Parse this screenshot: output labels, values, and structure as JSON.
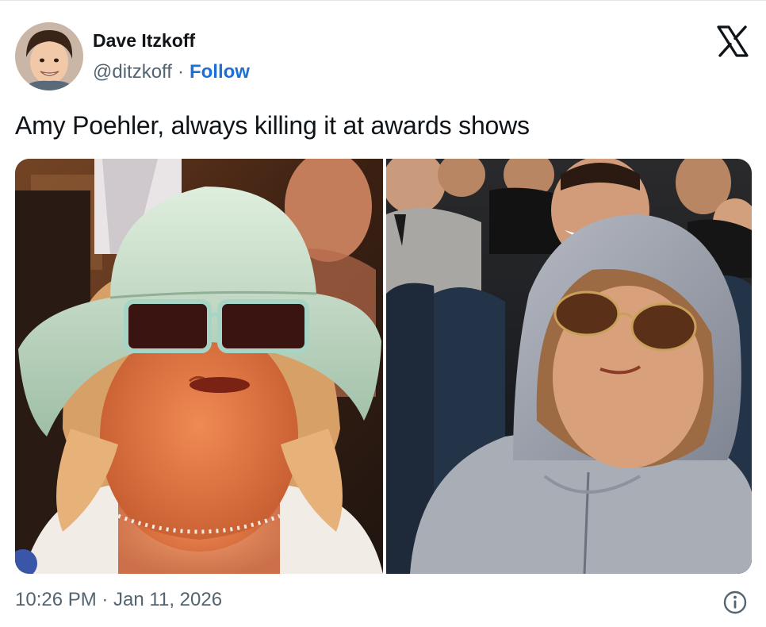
{
  "author": {
    "display_name": "Dave Itzkoff",
    "handle": "@ditzkoff",
    "separator": "·",
    "follow_label": "Follow"
  },
  "tweet": {
    "text": "Amy Poehler, always killing it at awards shows",
    "timestamp": "10:26 PM · Jan 11, 2026"
  },
  "media": {
    "count": 2,
    "items": [
      "photo-left",
      "photo-right"
    ]
  },
  "icons": {
    "brand": "x-logo-icon",
    "info": "info-icon"
  },
  "colors": {
    "text_primary": "#0f1419",
    "text_secondary": "#536471",
    "link": "#1d6fd8",
    "background": "#ffffff"
  }
}
